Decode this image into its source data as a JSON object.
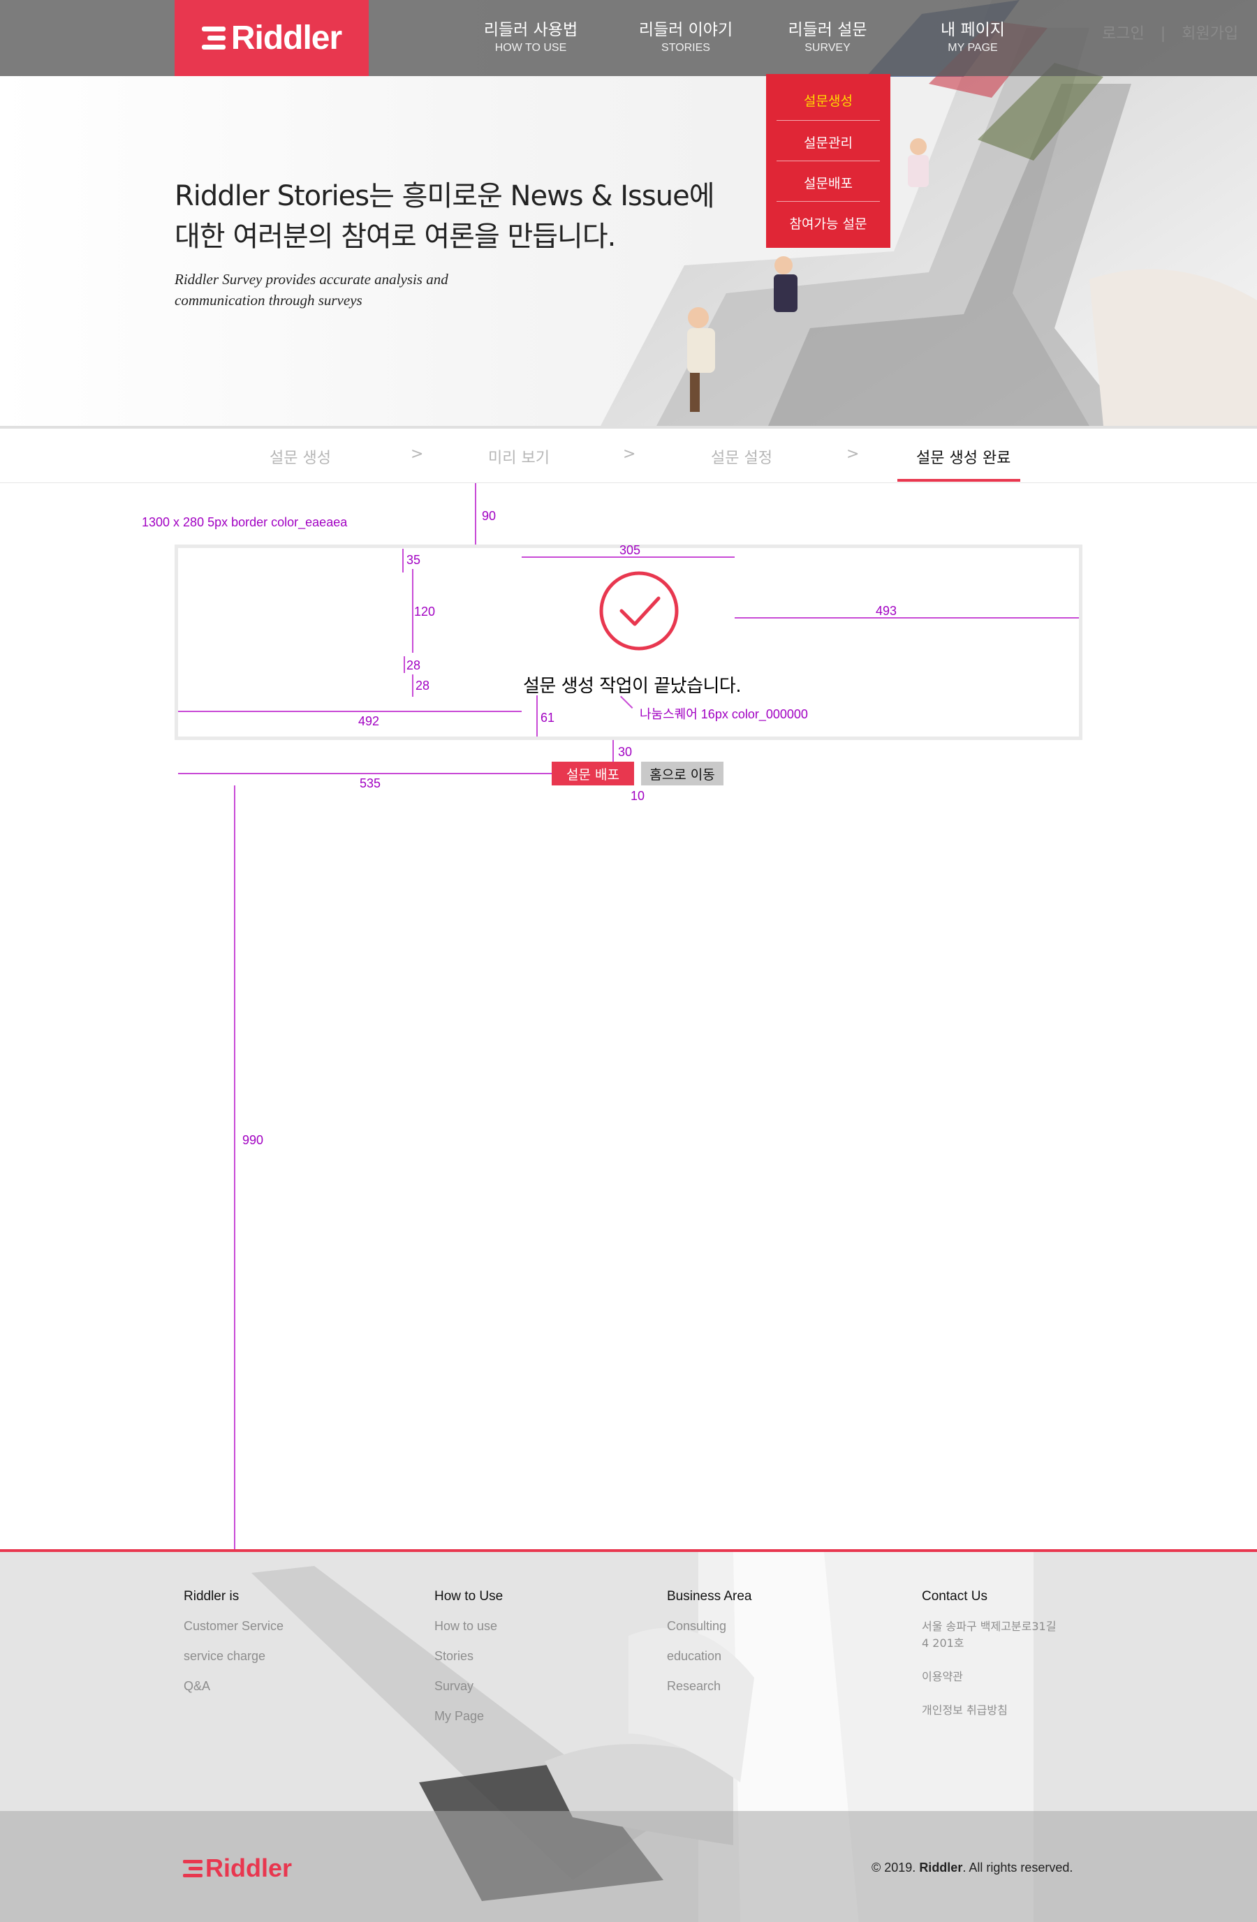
{
  "brand": {
    "name": "Riddler",
    "color": "#e8374f"
  },
  "nav": [
    {
      "ko": "리들러 사용법",
      "en": "HOW TO USE"
    },
    {
      "ko": "리들러 이야기",
      "en": "STORIES"
    },
    {
      "ko": "리들러 설문",
      "en": "SURVEY"
    },
    {
      "ko": "내 페이지",
      "en": "MY PAGE"
    }
  ],
  "auth": {
    "login": "로그인",
    "divider": "|",
    "signup": "회원가입"
  },
  "survey_menu": {
    "items": [
      "설문생성",
      "설문관리",
      "설문배포",
      "참여가능 설문"
    ],
    "active_color": "#ffdc00"
  },
  "hero": {
    "title_line1": "Riddler Stories는 흥미로운 News & Issue에",
    "title_line2": "대한 여러분의 참여로 여론을 만듭니다.",
    "sub_line1": "Riddler Survey provides accurate analysis and",
    "sub_line2": "communication through surveys"
  },
  "steps": {
    "items": [
      "설문 생성",
      "미리 보기",
      "설문 설정",
      "설문 생성 완료"
    ],
    "separator": ">",
    "active_index": 3
  },
  "completion": {
    "message": "설문 생성 작업이 끝났습니다.",
    "primary_button": "설문 배포",
    "secondary_button": "홈으로 이동"
  },
  "annotations": {
    "box_spec": "1300 x 280   5px border color_eaeaea",
    "font_spec": "나눔스퀘어 16px  color_000000",
    "labels": [
      "90",
      "35",
      "305",
      "120",
      "493",
      "28",
      "28",
      "492",
      "61",
      "30",
      "535",
      "10",
      "990"
    ],
    "color": "#a100c2"
  },
  "footer": {
    "columns": [
      {
        "heading": "Riddler is",
        "links": [
          "Customer Service",
          "service charge",
          "Q&A"
        ]
      },
      {
        "heading": "How to Use",
        "links": [
          "How to use",
          "Stories",
          "Survay",
          "My Page"
        ]
      },
      {
        "heading": "Business Area",
        "links": [
          "Consulting",
          "education",
          "Research"
        ]
      },
      {
        "heading": "Contact Us",
        "links": [
          "서울 송파구 백제고분로31길 4 201호",
          "이용약관",
          "개인정보 취급방침"
        ]
      }
    ],
    "copyright_prefix": "© 2019. ",
    "copyright_brand": "Riddler",
    "copyright_suffix": ". All rights reserved."
  }
}
